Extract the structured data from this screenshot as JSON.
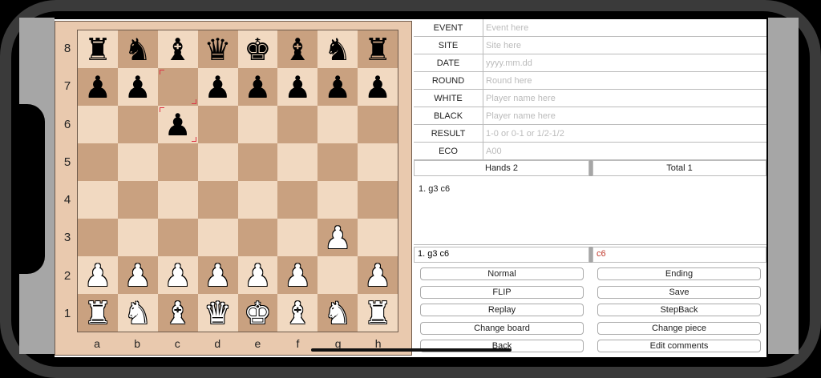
{
  "board": {
    "ranks": [
      "8",
      "7",
      "6",
      "5",
      "4",
      "3",
      "2",
      "1"
    ],
    "files": [
      "a",
      "b",
      "c",
      "d",
      "e",
      "f",
      "g",
      "h"
    ],
    "position": [
      [
        "bR",
        "bN",
        "bB",
        "bQ",
        "bK",
        "bB",
        "bN",
        "bR"
      ],
      [
        "bP",
        "bP",
        "",
        "bP",
        "bP",
        "bP",
        "bP",
        "bP"
      ],
      [
        "",
        "",
        "bP",
        "",
        "",
        "",
        "",
        ""
      ],
      [
        "",
        "",
        "",
        "",
        "",
        "",
        "",
        ""
      ],
      [
        "",
        "",
        "",
        "",
        "",
        "",
        "",
        ""
      ],
      [
        "",
        "",
        "",
        "",
        "",
        "",
        "wP",
        ""
      ],
      [
        "wP",
        "wP",
        "wP",
        "wP",
        "wP",
        "wP",
        "",
        "wP"
      ],
      [
        "wR",
        "wN",
        "wB",
        "wQ",
        "wK",
        "wB",
        "wN",
        "wR"
      ]
    ],
    "highlighted": [
      "c7",
      "c6"
    ]
  },
  "headers": [
    {
      "label": "EVENT",
      "placeholder": "Event here"
    },
    {
      "label": "SITE",
      "placeholder": "Site here"
    },
    {
      "label": "DATE",
      "placeholder": "yyyy.mm.dd"
    },
    {
      "label": "ROUND",
      "placeholder": "Round here"
    },
    {
      "label": "WHITE",
      "placeholder": "Player name here"
    },
    {
      "label": "BLACK",
      "placeholder": "Player name here"
    },
    {
      "label": "RESULT",
      "placeholder": "1-0 or 0-1 or 1/2-1/2"
    },
    {
      "label": "ECO",
      "placeholder": "A00"
    }
  ],
  "tabs": {
    "hands": "Hands 2",
    "total": "Total 1"
  },
  "moves_text": "1. g3 c6",
  "current_move": {
    "left": "1.  g3 c6",
    "right": "c6",
    "right_color": "#c0392b"
  },
  "buttons": {
    "normal": "Normal",
    "ending": "Ending",
    "flip": "FLIP",
    "save": "Save",
    "replay": "Replay",
    "stepback": "StepBack",
    "change_board": "Change board",
    "change_piece": "Change piece",
    "back": "Back",
    "edit_comments": "Edit comments"
  }
}
